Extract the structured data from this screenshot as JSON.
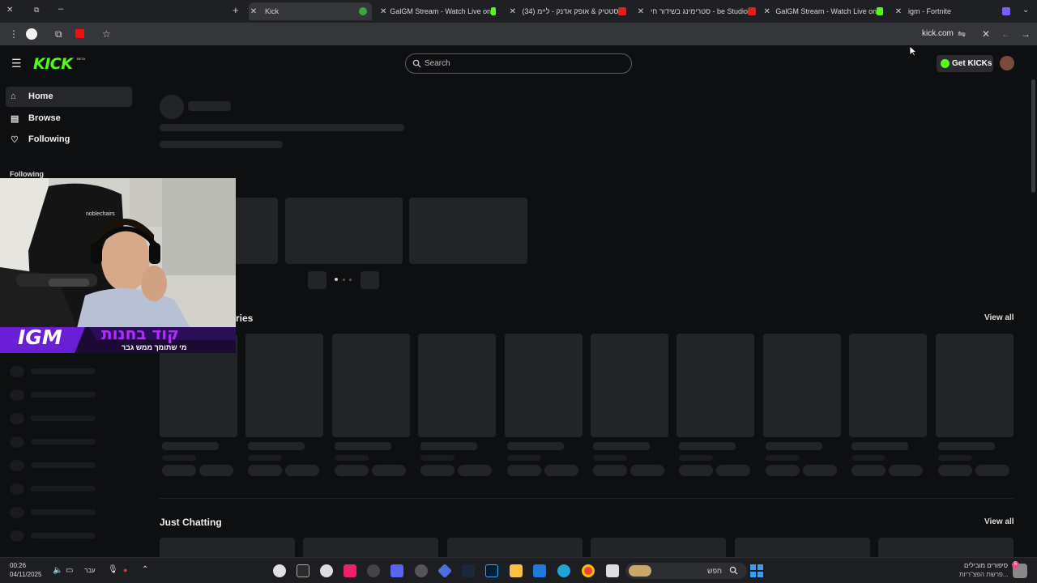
{
  "browser": {
    "tabs": [
      {
        "title": "Kick",
        "active": true
      },
      {
        "title": "GalGM Stream - Watch Live on"
      },
      {
        "title": "(34) סטטיק & אופק אדנק - ליימ"
      },
      {
        "title": "סטרימינג בשידור חי - be Studio"
      },
      {
        "title": "GalGM Stream - Watch Live on"
      },
      {
        "title": "igm - Fortnite"
      }
    ],
    "address": "kick.com"
  },
  "kick": {
    "logo": "KICK",
    "beta": "BETA",
    "search_placeholder": "Search",
    "get_kicks": "Get KICKs",
    "accent": "#53fc18"
  },
  "sidebar": {
    "items": [
      {
        "label": "Home",
        "icon": "home-icon"
      },
      {
        "label": "Browse",
        "icon": "browse-icon"
      },
      {
        "label": "Following",
        "icon": "heart-icon"
      }
    ],
    "following_header": "Following"
  },
  "main": {
    "categories_title": "ries",
    "categories_view_all": "View all",
    "just_chatting_title": "Just Chatting",
    "just_chatting_view_all": "View all"
  },
  "overlay": {
    "brand": "IGM",
    "headline": "קוד בחנות",
    "subline": "מי שתומך ממש גבר",
    "chair_label": "noblechairs"
  },
  "taskbar": {
    "time": "00:26",
    "date": "04/11/2025",
    "lang": "עבר",
    "search_placeholder": "חפש",
    "news_title": "סיפורים מובילים",
    "news_sub": "פרשת הפצ\"ריות...",
    "news_badge": "5"
  }
}
